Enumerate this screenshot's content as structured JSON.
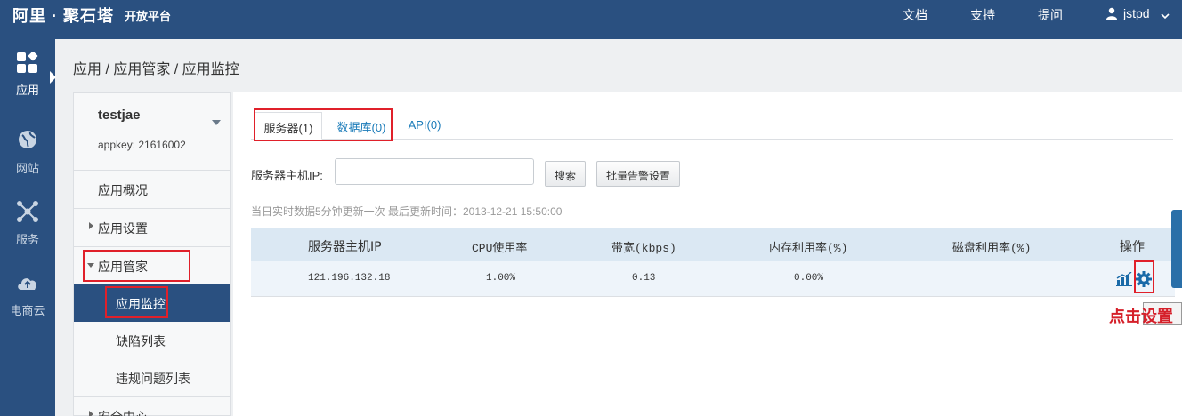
{
  "header": {
    "brand": "阿里 · 聚石塔",
    "brand_sub": "开放平台",
    "nav": [
      "文档",
      "支持",
      "提问"
    ],
    "user": "jstpd"
  },
  "rail": [
    {
      "label": "应用",
      "icon": "apps-icon"
    },
    {
      "label": "网站",
      "icon": "globe-icon"
    },
    {
      "label": "服务",
      "icon": "network-icon"
    },
    {
      "label": "电商云",
      "icon": "cloud-upload-icon"
    }
  ],
  "breadcrumb": "应用 / 应用管家 / 应用监控",
  "app": {
    "name": "testjae",
    "appkey": "appkey: 21616002"
  },
  "menu": {
    "overview": "应用概况",
    "settings": "应用设置",
    "manager": "应用管家",
    "monitor": "应用监控",
    "defects": "缺陷列表",
    "violations": "违规问题列表",
    "security": "安全中心"
  },
  "tabs": [
    "服务器(1)",
    "数据库(0)",
    "API(0)"
  ],
  "search": {
    "label": "服务器主机IP:",
    "value": "",
    "search_button": "搜索",
    "alert_button": "批量告警设置"
  },
  "status_text": "当日实时数据5分钟更新一次 最后更新时间：2013-12-21 15:50:00",
  "table": {
    "headers": [
      "服务器主机IP",
      "CPU使用率",
      "带宽(kbps)",
      "内存利用率(%)",
      "磁盘利用率(%)",
      "操作"
    ],
    "rows": [
      [
        "121.196.132.18",
        "1.00%",
        "0.13",
        "0.00%",
        ""
      ]
    ]
  },
  "callout": "点击设置",
  "colors": {
    "nav_bg": "#2a5080",
    "highlight_red": "#e0202a",
    "link_blue": "#1a7bb9"
  }
}
